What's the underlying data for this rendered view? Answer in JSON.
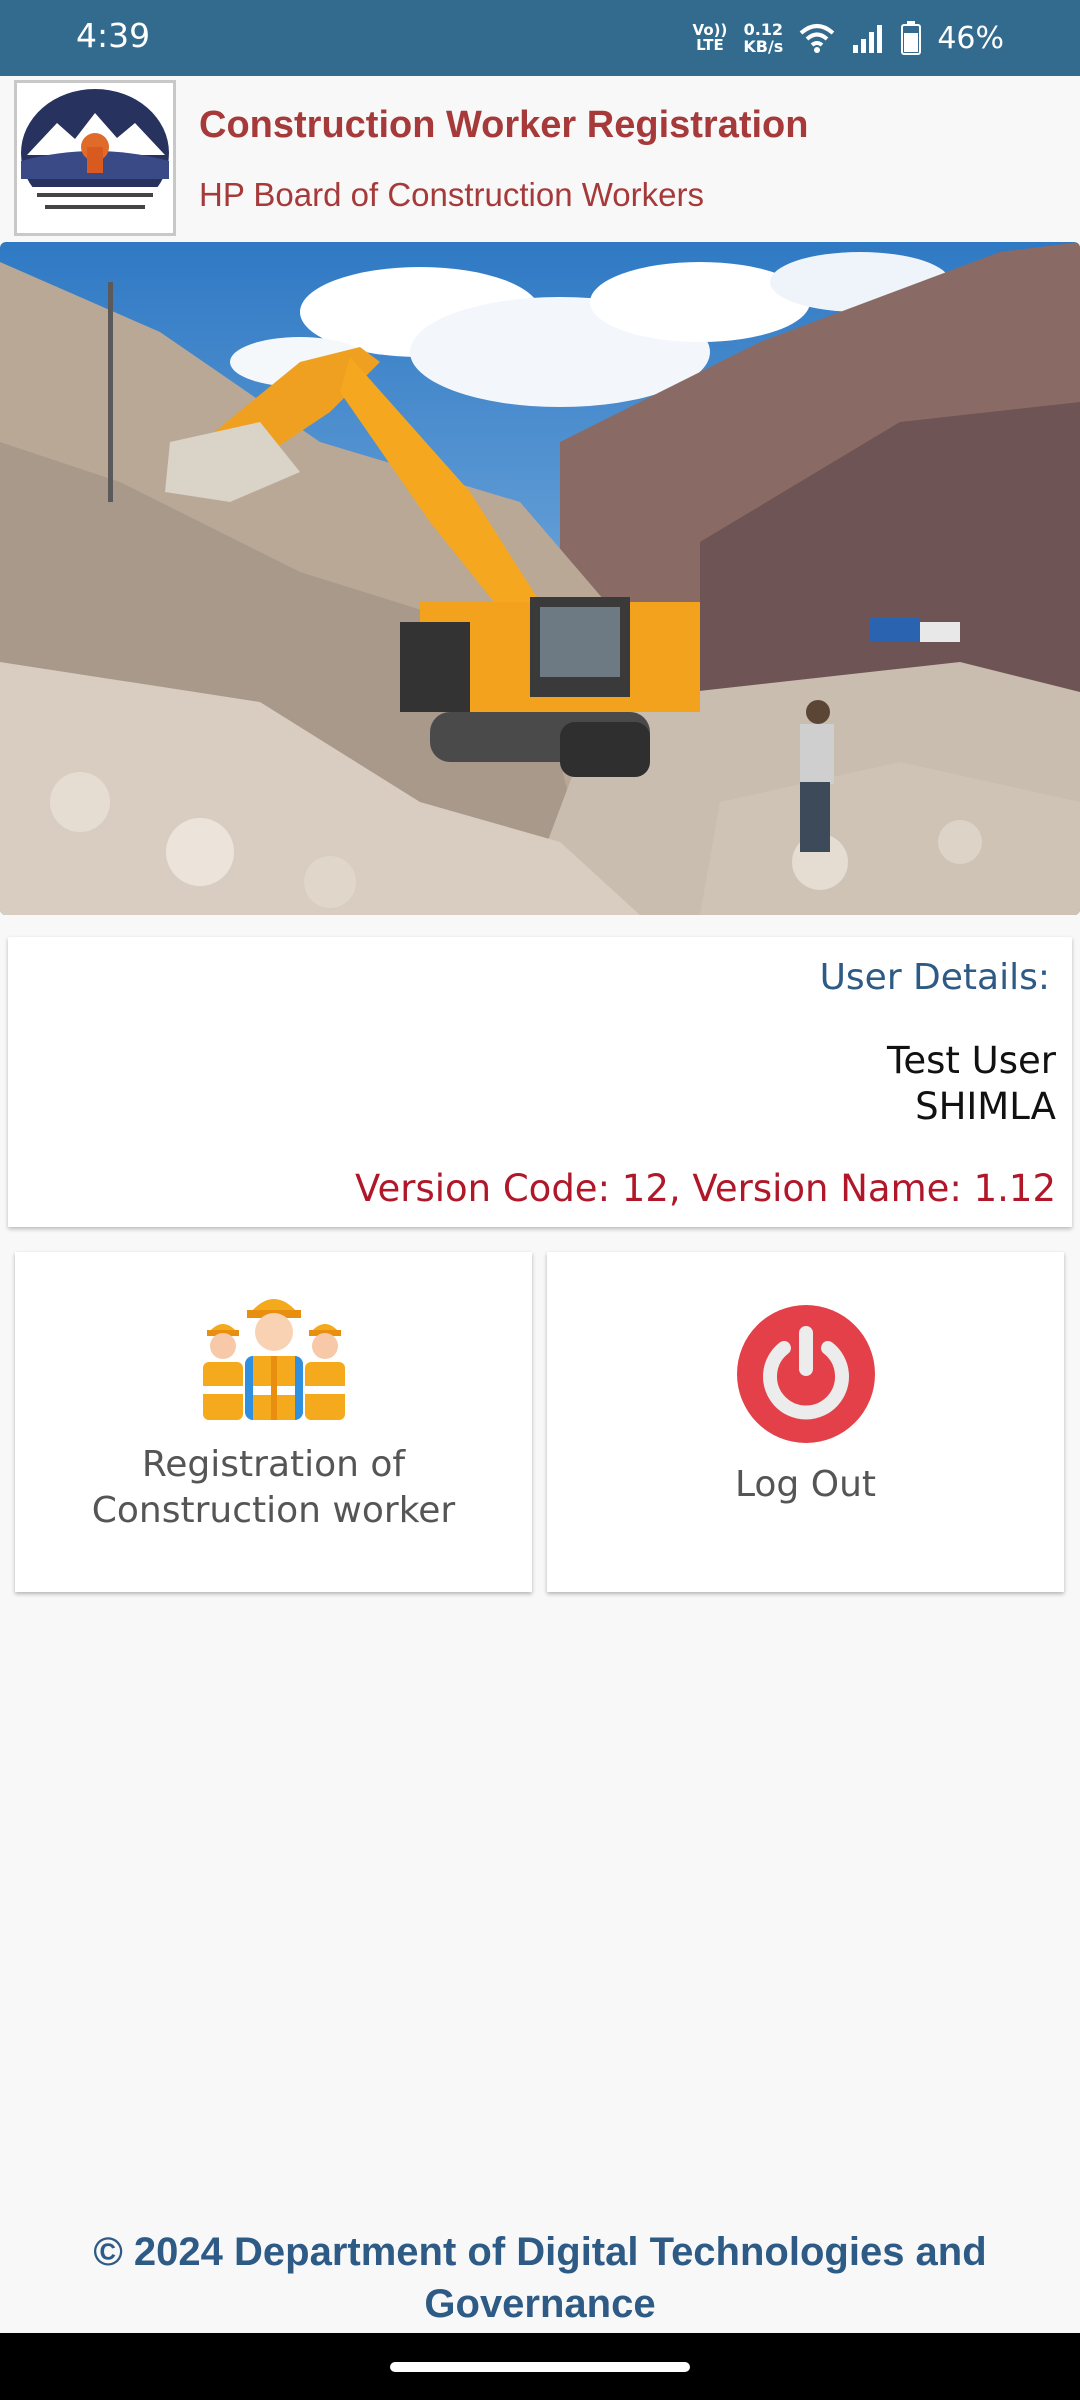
{
  "status_bar": {
    "time": "4:39",
    "volte_top": "Vo))",
    "volte_bottom": "LTE",
    "speed_value": "0.12",
    "speed_unit": "KB/s",
    "battery": "46%",
    "icons": [
      "volte-icon",
      "wifi-icon",
      "signal-icon",
      "battery-icon"
    ]
  },
  "header": {
    "title": "Construction Worker Registration",
    "subtitle": "HP Board of Construction Workers",
    "title_color": "#a63a3a"
  },
  "banner": {
    "slide_count": 2,
    "active_slide": 1
  },
  "user_details": {
    "label": "User Details:",
    "name": "Test User",
    "district": "SHIMLA",
    "version": "Version Code: 12, Version Name: 1.12"
  },
  "menu": {
    "registration_label": "Registration of Construction worker",
    "registration_icon": "construction-workers-icon",
    "logout_label": "Log Out",
    "logout_icon": "power-icon",
    "logout_color": "#e3404a"
  },
  "footer": {
    "text": "© 2024 Department of Digital Technologies and Governance",
    "color": "#2e5b86"
  }
}
